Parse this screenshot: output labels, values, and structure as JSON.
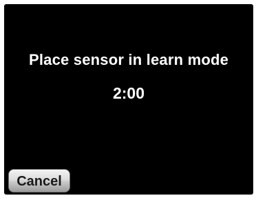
{
  "dialog": {
    "message": "Place sensor in learn mode",
    "countdown": "2:00",
    "cancel_label": "Cancel"
  },
  "colors": {
    "background": "#000000",
    "text": "#ffffff",
    "button_text": "#1a1a1a",
    "button_face": "#d6d6d6"
  }
}
